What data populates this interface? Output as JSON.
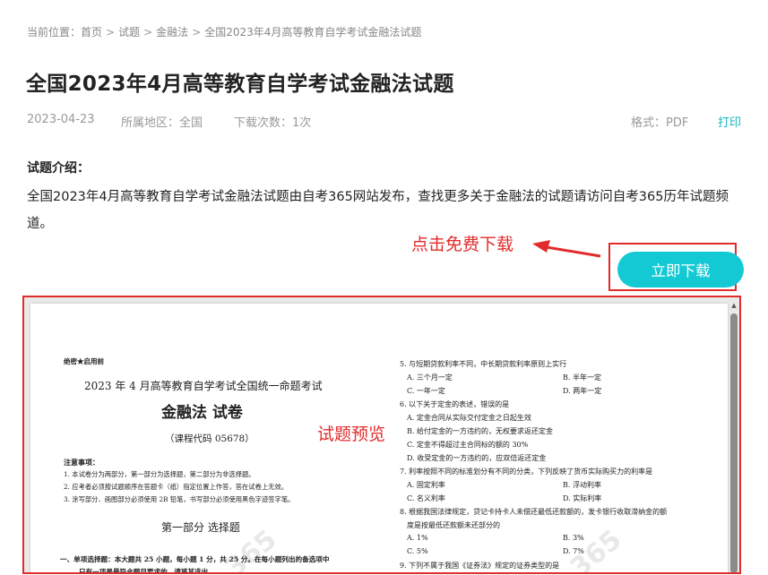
{
  "breadcrumb": {
    "prefix": "当前位置：",
    "items": [
      "首页",
      "试题",
      "金融法",
      "全国2023年4月高等教育自学考试金融法试题"
    ],
    "separator": ">"
  },
  "page_title": "全国2023年4月高等教育自学考试金融法试题",
  "meta": {
    "date": "2023-04-23",
    "region": "所属地区：全国",
    "downloads": "下载次数：1次",
    "format": "格式：PDF",
    "print_label": "打印"
  },
  "intro": {
    "heading": "试题介绍：",
    "text": "全国2023年4月高等教育自学考试金融法试题由自考365网站发布，查找更多关于金融法的试题请访问自考365历年试题频道。"
  },
  "annotations": {
    "download_hint": "点击免费下载",
    "preview_label": "试题预览"
  },
  "download_button": "立即下载",
  "preview": {
    "left": {
      "confidential": "绝密★启用前",
      "exam_title": "2023 年 4 月高等教育自学考试全国统一命题考试",
      "subject": "金融法   试卷",
      "course_code": "（课程代码   05678）",
      "notes_heading": "注意事项：",
      "notes": [
        "1.  本试卷分为两部分，第一部分为选择题，第二部分为非选择题。",
        "2.  应考者必须按试题顺序在答题卡（纸）指定位置上作答，答在试卷上无效。",
        "3.  涂写部分、画图部分必须使用 2B 铅笔，书写部分必须使用黑色字迹签字笔。"
      ],
      "part_title": "第一部分    选择题",
      "section_line1": "一、单项选择题：本大题共 25 小题，每小题 1 分，共 25 分。在每小题列出的备选项中",
      "section_line2": "只有一项是最符合题目要求的，请将其选出。"
    },
    "right": {
      "q5": "5.  与短期贷款利率不同，中长期贷款利率原则上实行",
      "q5_opts": [
        "A.  三个月一定",
        "B.  半年一定",
        "C.  一年一定",
        "D.  两年一定"
      ],
      "q6": "6.  以下关于定金的表述，错误的是",
      "q6_opts": [
        "A.  定金合同从实际交付定金之日起生效",
        "B.  给付定金的一方违约的，无权要求返还定金",
        "C.  定金不得超过主合同标的额的 30%",
        "D.  收受定金的一方违约的，应双倍返还定金"
      ],
      "q7": "7.  利率按照不同的标准划分有不同的分类，下列反映了货币实际购买力的利率是",
      "q7_opts": [
        "A.  固定利率",
        "B.  浮动利率",
        "C.  名义利率",
        "D.  实际利率"
      ],
      "q8_line1": "8.  根据我国法律规定，贷记卡持卡人未偿还最低还款额的，发卡银行收取滞纳金的额",
      "q8_line2": "度是按最低还款额未还部分的",
      "q8_opts": [
        "A.  1%",
        "B.  3%",
        "C.  5%",
        "D.  7%"
      ],
      "q9": "9.  下列不属于我国《证券法》规定的证券类型的是"
    }
  }
}
